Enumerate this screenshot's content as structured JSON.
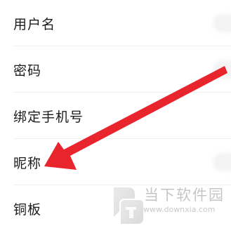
{
  "settings": {
    "items": [
      {
        "label": "用户名"
      },
      {
        "label": "密码"
      },
      {
        "label": "绑定手机号"
      },
      {
        "label": "昵称"
      },
      {
        "label": "铜板"
      }
    ]
  },
  "annotation": {
    "arrow_color": "#e8242c",
    "icon": "arrow-pointer-icon"
  },
  "watermark": {
    "name": "当下软件园",
    "url": "www.downxia.com",
    "logo_icon": "downxia-logo-icon"
  }
}
